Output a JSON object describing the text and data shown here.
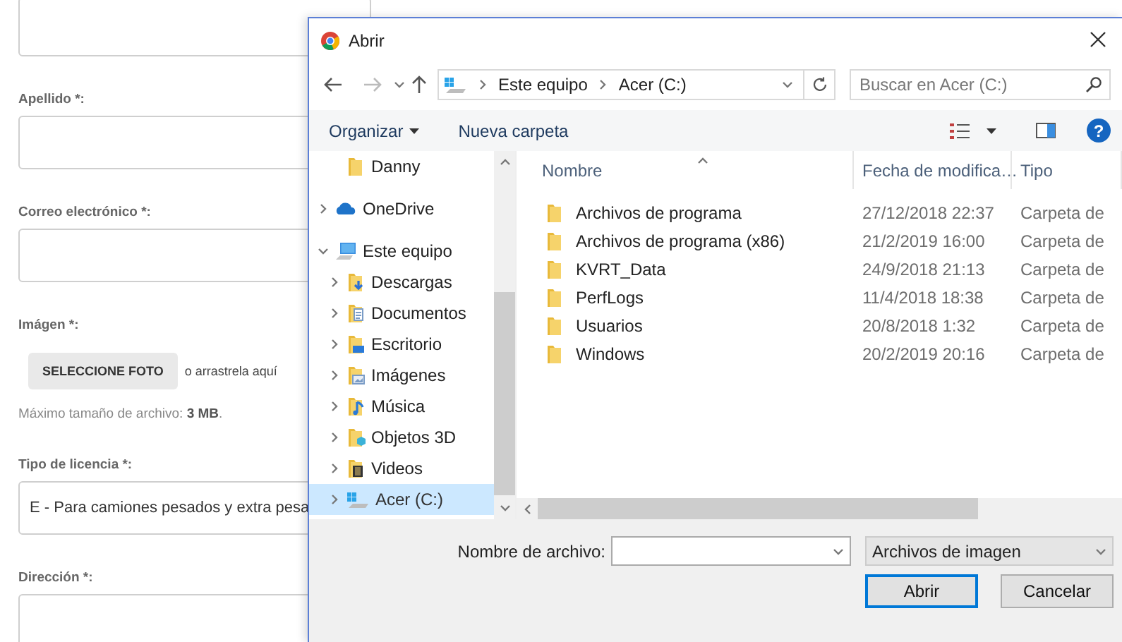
{
  "form": {
    "fields": [
      {
        "kind": "input"
      },
      {
        "kind": "input",
        "label": "Apellido *:"
      },
      {
        "kind": "input",
        "label": "Correo electrónico *:"
      },
      {
        "kind": "upload",
        "label": "Imágen *:",
        "button": "SELECCIONE FOTO",
        "hint": "o arrastrela aquí",
        "note": "Máximo tamaño de archivo: **3 MB**."
      },
      {
        "kind": "select",
        "label": "Tipo de licencia *:",
        "value": "E - Para camiones pesados y extra pesa"
      },
      {
        "kind": "textarea",
        "label": "Dirección *:"
      }
    ]
  },
  "dialog": {
    "title": "Abrir",
    "breadcrumb": [
      "Este equipo",
      "Acer (C:)"
    ],
    "search": {
      "placeholder": "Buscar en Acer (C:)"
    },
    "toolbar": {
      "organize": "Organizar",
      "new_folder": "Nueva carpeta",
      "help": "?"
    },
    "nav_items": [
      {
        "children": [
          {
            "label": "Danny",
            "kind": "folder",
            "has_children": false,
            "selected": false
          }
        ]
      },
      {
        "label": "OneDrive",
        "kind": "cloud",
        "has_children": true,
        "expanded": false,
        "selected": false
      },
      {
        "label": "Este equipo",
        "kind": "computer",
        "has_children": true,
        "expanded": true,
        "selected": false,
        "children": [
          {
            "label": "Descargas",
            "kind": "downloads",
            "has_children": true,
            "expanded": false,
            "selected": false
          },
          {
            "label": "Documentos",
            "kind": "documents",
            "has_children": true,
            "expanded": false,
            "selected": false
          },
          {
            "label": "Escritorio",
            "kind": "desktop",
            "has_children": true,
            "expanded": false,
            "selected": false
          },
          {
            "label": "Imágenes",
            "kind": "pictures",
            "has_children": true,
            "expanded": false,
            "selected": false
          },
          {
            "label": "Música",
            "kind": "music",
            "has_children": true,
            "expanded": false,
            "selected": false
          },
          {
            "label": "Objetos 3D",
            "kind": "objects",
            "has_children": true,
            "expanded": false,
            "selected": false
          },
          {
            "label": "Videos",
            "kind": "videos",
            "has_children": true,
            "expanded": false,
            "selected": false
          },
          {
            "label": "Acer (C:)",
            "kind": "drive",
            "has_children": true,
            "expanded": false,
            "selected": true
          }
        ]
      }
    ],
    "columns": [
      "Nombre",
      "Fecha de modifica…",
      "Tipo"
    ],
    "files": [
      {
        "name": "Archivos de programa",
        "modified": "27/12/2018 22:37",
        "type": "Carpeta de"
      },
      {
        "name": "Archivos de programa (x86)",
        "modified": "21/2/2019 16:00",
        "type": "Carpeta de"
      },
      {
        "name": "KVRT_Data",
        "modified": "24/9/2018 21:13",
        "type": "Carpeta de"
      },
      {
        "name": "PerfLogs",
        "modified": "11/4/2018 18:38",
        "type": "Carpeta de"
      },
      {
        "name": "Usuarios",
        "modified": "20/8/2018 1:32",
        "type": "Carpeta de"
      },
      {
        "name": "Windows",
        "modified": "20/2/2019 20:16",
        "type": "Carpeta de"
      }
    ],
    "filename": {
      "label": "Nombre de archivo:"
    },
    "filter": "Archivos de imagen",
    "buttons": [
      {
        "label": "Abrir",
        "default": true
      },
      {
        "label": "Cancelar",
        "default": false
      }
    ]
  }
}
